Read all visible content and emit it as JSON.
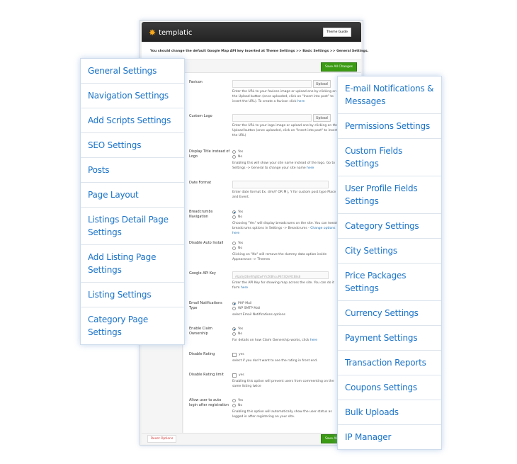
{
  "header": {
    "logo": "templatic",
    "theme_guide": "Theme Guide"
  },
  "notice": "You should change the default Google Map API key inserted at Theme Settings >> Basic Settings >> General Settings.",
  "save_label": "Save All Changes",
  "reset_label": "Reset Options",
  "fields": {
    "favicon": {
      "label": "Favicon",
      "button": "Upload",
      "desc": "Enter the URL to your favicon image or upload one by clicking on the Upload button (once uploaded, click on \"Insert into post\" to insert the URL). To create a favicon click",
      "link": "here"
    },
    "logo": {
      "label": "Custom Logo",
      "button": "Upload",
      "desc": "Enter the URL to your logo image or upload one by clicking on the Upload button (once uploaded, click on \"Insert into post\" to insert the URL)"
    },
    "display_title": {
      "label": "Display Title instead of Logo",
      "opts": [
        "Yes",
        "No"
      ],
      "desc": "Enabling this will show your site name instead of the logo. Go to Settings -> General to change your site name",
      "link": "here"
    },
    "date_format": {
      "label": "Date Format",
      "desc": "Enter date format Ex. d/m/Y OR M j, Y for custom post type Place and Event."
    },
    "breadcrumbs": {
      "label": "Breadcrumbs Navigation",
      "opts": [
        "Yes",
        "No"
      ],
      "selected": "Yes",
      "desc": "Choosing \"Yes\" will display breadcrums on the site. You can tweak breadcrums options in Settings -> Breadcrums -",
      "link": "Change options here"
    },
    "auto_install": {
      "label": "Disable Auto Install",
      "opts": [
        "Yes",
        "No"
      ],
      "desc": "Clicking on \"No\" will remove the dummy data option inside Appearance -> Themes"
    },
    "api_key": {
      "label": "Google API Key",
      "value": "AIzaSyDEeRfiqBZwFYhZ6BhcuP873QhMCE8s8",
      "desc": "Enter the API Key for showing map across the site. You can do it form",
      "link": "here"
    },
    "email_type": {
      "label": "Email Notifications Type",
      "opts": [
        "PHP Mail",
        "WP SMTP Mail"
      ],
      "selected": "PHP Mail",
      "desc": "select Email Notifications options"
    },
    "claim": {
      "label": "Enable Claim Ownership",
      "opts": [
        "Yes",
        "No"
      ],
      "selected": "Yes",
      "desc": "For details on how Claim Ownership works, click",
      "link": "here"
    },
    "rating": {
      "label": "Disable Rating",
      "check": "yes",
      "desc": "select if you don't want to see the rating in front end."
    },
    "rating_limit": {
      "label": "Disable Rating limit",
      "check": "yes",
      "desc": "Enabling this option will prevent users from commenting on the same listing twice"
    },
    "auto_login": {
      "label": "Allow user to auto login after registration",
      "opts": [
        "Yes",
        "No"
      ],
      "desc": "Enabling this option will automatically show the user status as logged in after registering on your site."
    }
  },
  "left_menu": [
    "General Settings",
    "Navigation Settings",
    "Add Scripts Settings",
    "SEO Settings",
    "Posts",
    "Page Layout",
    "Listings Detail Page Settings",
    "Add Listing Page Settings",
    "Listing Settings",
    "Category Page Settings"
  ],
  "right_menu": [
    "E-mail Notifications & Messages",
    "Permissions Settings",
    "Custom Fields Settings",
    "User Profile Fields Settings",
    "Category Settings",
    "City Settings",
    "Price Packages Settings",
    "Currency Settings",
    "Payment Settings",
    "Transaction Reports",
    "Coupons Settings",
    "Bulk Uploads",
    "IP Manager"
  ]
}
